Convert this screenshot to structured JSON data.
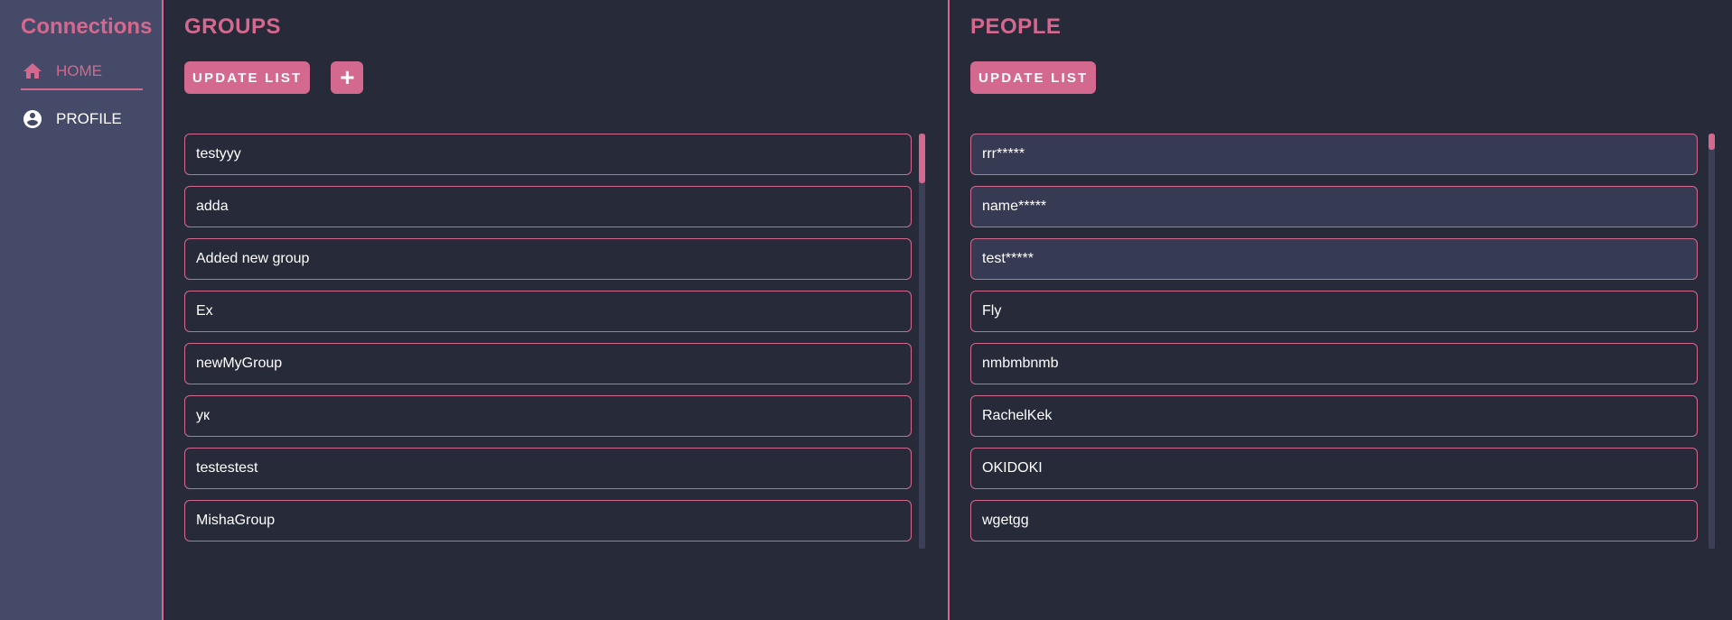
{
  "sidebar": {
    "brand": "Connections",
    "items": [
      {
        "label": "HOME",
        "icon": "home-icon",
        "active": true
      },
      {
        "label": "PROFILE",
        "icon": "account-circle-icon",
        "active": false
      }
    ]
  },
  "groups": {
    "title": "GROUPS",
    "update_label": "UPDATE LIST",
    "add_label": "+",
    "items": [
      "testyyy",
      "adda",
      "Added new group",
      "Ex",
      "newMyGroup",
      "ук",
      "testestest",
      "MishaGroup"
    ],
    "scroll_thumb_fraction": 0.12
  },
  "people": {
    "title": "PEOPLE",
    "update_label": "UPDATE LIST",
    "items": [
      "rrr*****",
      "name*****",
      "test*****",
      "Fly",
      "nmbmbnmb",
      "RachelKek",
      "OKIDOKI",
      "wgetgg"
    ],
    "scroll_thumb_fraction": 0.04
  },
  "colors": {
    "accent": "#d4698f",
    "background": "#272a39",
    "sidebar": "#444a67"
  }
}
